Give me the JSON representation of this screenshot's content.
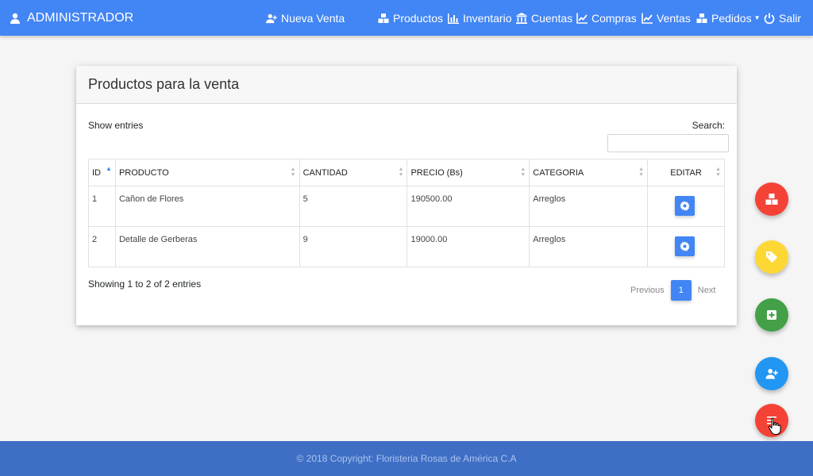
{
  "navbar": {
    "brand": "ADMINISTRADOR",
    "new_sale": "Nueva Venta",
    "items": {
      "productos": "Productos",
      "inventario": "Inventario",
      "cuentas": "Cuentas",
      "compras": "Compras",
      "ventas": "Ventas",
      "pedidos": "Pedidos",
      "salir": "Salir"
    }
  },
  "card": {
    "title": "Productos para la venta",
    "show_entries": "Show entries",
    "search_label": "Search:",
    "search_value": "",
    "columns": [
      "ID",
      "PRODUCTO",
      "CANTIDAD",
      "PRECIO (Bs)",
      "CATEGORIA",
      "EDITAR"
    ],
    "rows": [
      {
        "id": "1",
        "producto": "Cañon de Flores",
        "cantidad": "5",
        "precio": "190500.00",
        "categoria": "Arreglos"
      },
      {
        "id": "2",
        "producto": "Detalle de Gerberas",
        "cantidad": "9",
        "precio": "19000.00",
        "categoria": "Arreglos"
      }
    ],
    "showing": "Showing 1 to 2 of 2 entries",
    "pagination": {
      "previous": "Previous",
      "current_page": "1",
      "next": "Next"
    }
  },
  "fabs": [
    {
      "icon": "cubes-icon",
      "color": "#f44336"
    },
    {
      "icon": "tags-icon",
      "color": "#fdd835"
    },
    {
      "icon": "plus-square-icon",
      "color": "#43a047"
    },
    {
      "icon": "user-plus-icon",
      "color": "#2196f3"
    },
    {
      "icon": "list-icon",
      "color": "#f44336"
    }
  ],
  "footer": {
    "text": "© 2018 Copyright: Floristeria Rosas de América C.A"
  },
  "colors": {
    "primary": "#4285f4",
    "footer": "#3f6fc4"
  }
}
